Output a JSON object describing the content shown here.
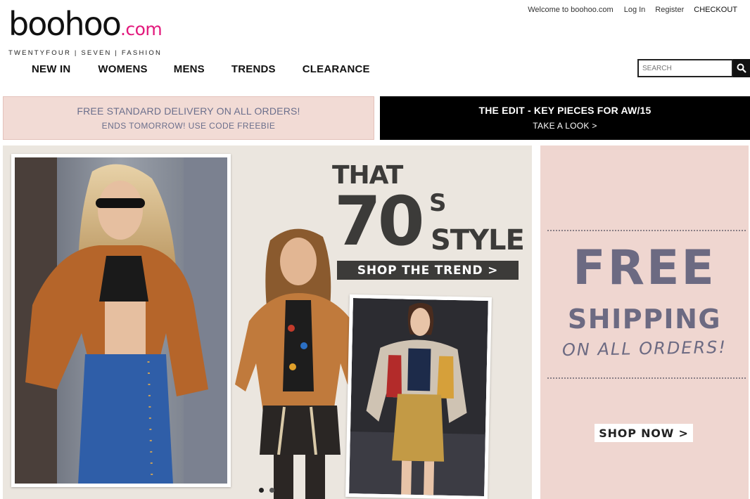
{
  "logo": {
    "word": "boohoo",
    "dotcom": ".com",
    "tagline": "TWENTYFOUR  |  SEVEN  |  FASHION",
    "dotcom_color": "#e2197c"
  },
  "top_links": {
    "welcome": "Welcome to boohoo.com",
    "login": "Log In",
    "register": "Register",
    "checkout": "CHECKOUT"
  },
  "nav": {
    "items": [
      {
        "label": "NEW IN"
      },
      {
        "label": "WOMENS"
      },
      {
        "label": "MENS"
      },
      {
        "label": "TRENDS"
      },
      {
        "label": "CLEARANCE"
      }
    ]
  },
  "search": {
    "placeholder": "SEARCH",
    "icon": "search-icon"
  },
  "promo": {
    "left": {
      "line1": "FREE STANDARD DELIVERY ON ALL ORDERS!",
      "line2": "ENDS TOMORROW! USE CODE FREEBIE"
    },
    "right": {
      "line1": "THE EDIT - KEY PIECES FOR AW/15",
      "line2": "TAKE A LOOK >"
    }
  },
  "hero": {
    "that": "THAT",
    "seventy": "70",
    "s": "S",
    "style": "STYLE",
    "cta": "SHOP THE TREND >",
    "slides": [
      {
        "active": true
      },
      {
        "active": false
      }
    ]
  },
  "shipping": {
    "free": "FREE",
    "shipping": "SHIPPING",
    "orders": "ON ALL ORDERS!",
    "cta": "SHOP NOW >"
  },
  "colors": {
    "promo_pink": "#f2dbd5",
    "promo_text": "#6b6f8c",
    "shipping_pink": "#efd6d0",
    "shipping_text": "#6c6a82",
    "hero_dark": "#3c3b39"
  }
}
